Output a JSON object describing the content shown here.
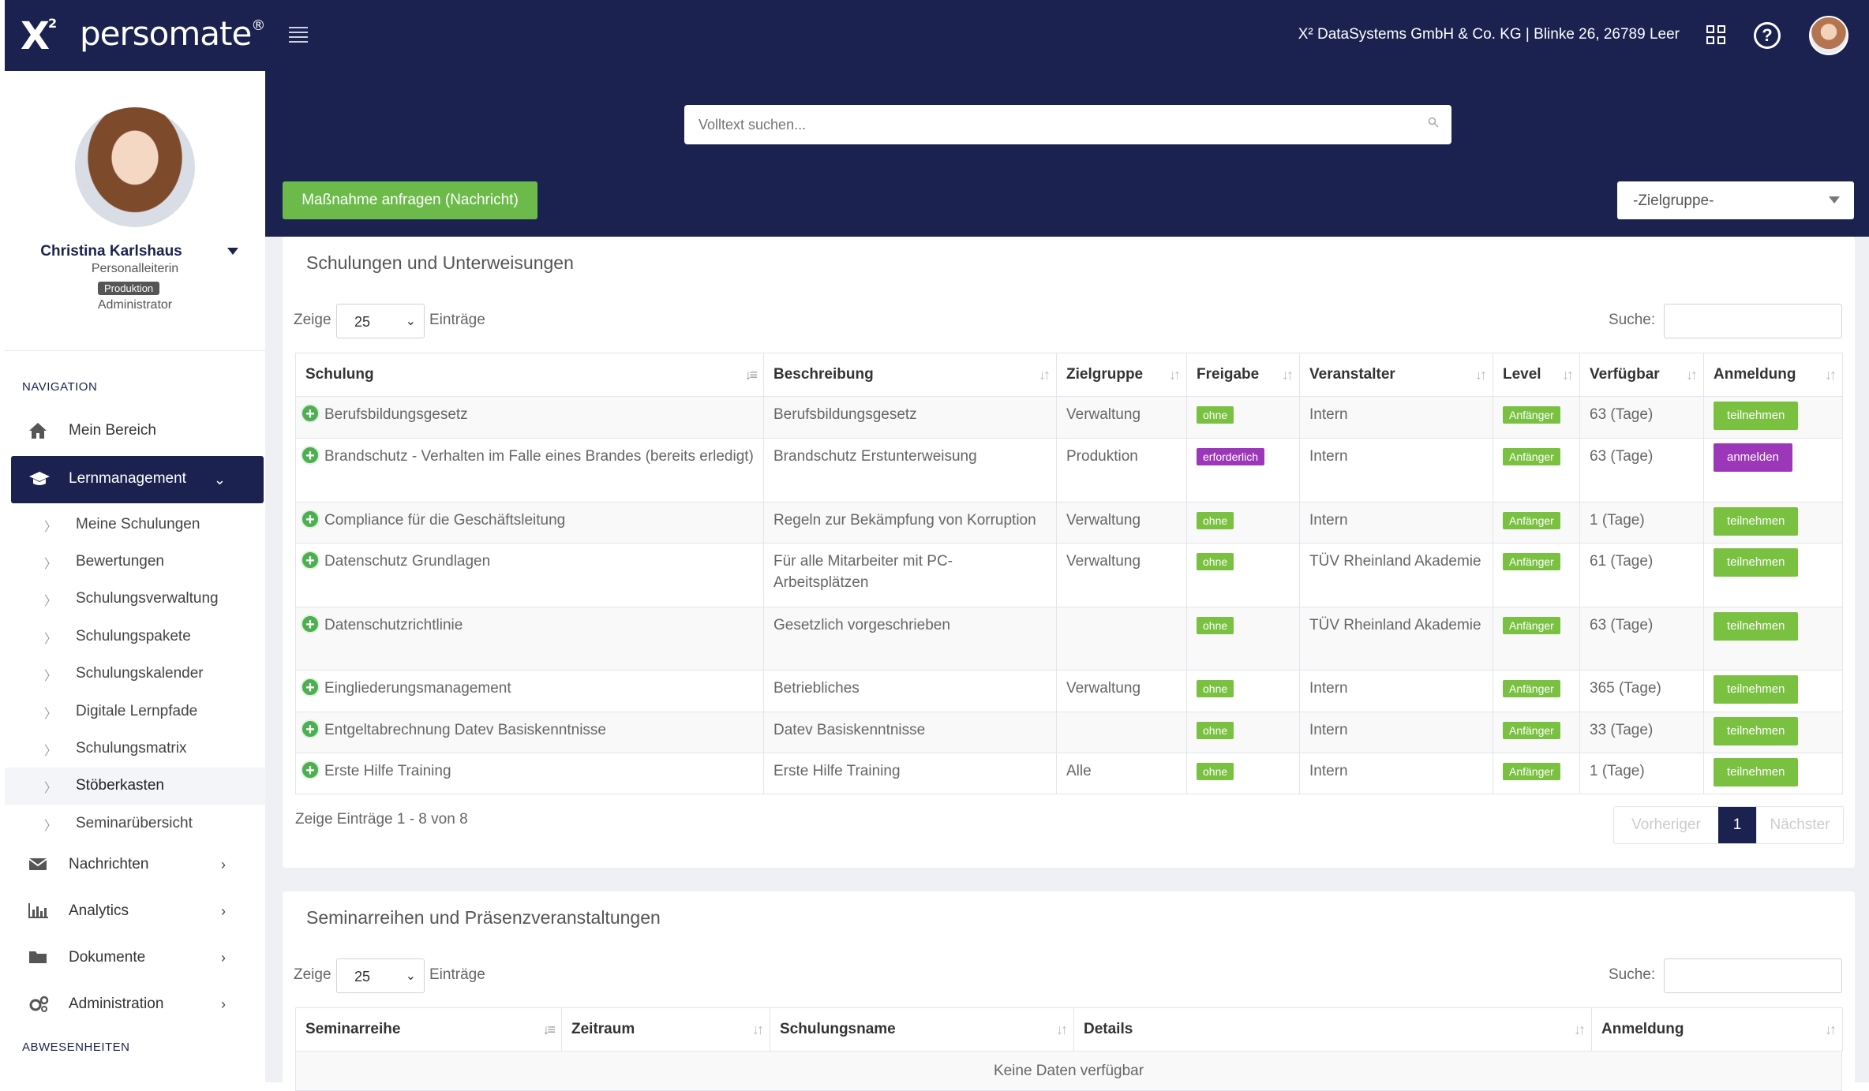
{
  "header": {
    "logo_x2": "X",
    "logo_sup": "2",
    "logo_name": "persomate",
    "logo_reg": "®",
    "company": "X² DataSystems GmbH & Co. KG | Blinke 26, 26789 Leer",
    "icons": [
      "menu-icon",
      "grid-icon",
      "help-icon",
      "avatar"
    ]
  },
  "profile": {
    "name": "Christina Karlshaus",
    "role": "Personalleiterin",
    "badge": "Produktion",
    "level": "Administrator"
  },
  "nav": {
    "title": "NAVIGATION",
    "mein_bereich": "Mein Bereich",
    "lernmanagement": "Lernmanagement",
    "sub_items": [
      "Meine Schulungen",
      "Bewertungen",
      "Schulungsverwaltung",
      "Schulungspakete",
      "Schulungskalender",
      "Digitale Lernpfade",
      "Schulungsmatrix",
      "Stöberkasten",
      "Seminarübersicht"
    ],
    "nachrichten": "Nachrichten",
    "analytics": "Analytics",
    "dokumente": "Dokumente",
    "administration": "Administration",
    "abwesenheiten": "ABWESENHEITEN"
  },
  "search": {
    "placeholder": "Volltext suchen..."
  },
  "request_button": "Maßnahme anfragen (Nachricht)",
  "zielgruppe_select": "-Zielgruppe-",
  "panel1": {
    "title": "Schulungen und Unterweisungen",
    "show_label": "Zeige",
    "show_value": "25",
    "entries_label": "Einträge",
    "search_label": "Suche:",
    "columns": [
      "Schulung",
      "Beschreibung",
      "Zielgruppe",
      "Freigabe",
      "Veranstalter",
      "Level",
      "Verfügbar",
      "Anmeldung"
    ],
    "rows": [
      {
        "schulung": "Berufsbildungsgesetz",
        "beschreibung": "Berufsbildungsgesetz",
        "zielgruppe": "Verwaltung",
        "freigabe": "ohne",
        "veranstalter": "Intern",
        "level": "Anfänger",
        "verfuegbar": "63  (Tage)",
        "anmeldung": "teilnehmen"
      },
      {
        "schulung": "Brandschutz - Verhalten im Falle eines Brandes (bereits erledigt)",
        "beschreibung": "Brandschutz Erstunterweisung",
        "zielgruppe": "Produktion",
        "freigabe": "erforderlich",
        "veranstalter": "Intern",
        "level": "Anfänger",
        "verfuegbar": "63  (Tage)",
        "anmeldung": "anmelden"
      },
      {
        "schulung": "Compliance für die Geschäftsleitung",
        "beschreibung": "Regeln zur Bekämpfung von Korruption",
        "zielgruppe": "Verwaltung",
        "freigabe": "ohne",
        "veranstalter": "Intern",
        "level": "Anfänger",
        "verfuegbar": "1  (Tage)",
        "anmeldung": "teilnehmen"
      },
      {
        "schulung": "Datenschutz Grundlagen",
        "beschreibung": "Für alle Mitarbeiter mit PC-Arbeitsplätzen",
        "zielgruppe": "Verwaltung",
        "freigabe": "ohne",
        "veranstalter": "TÜV Rheinland Akademie",
        "level": "Anfänger",
        "verfuegbar": "61  (Tage)",
        "anmeldung": "teilnehmen"
      },
      {
        "schulung": "Datenschutzrichtlinie",
        "beschreibung": "Gesetzlich vorgeschrieben",
        "zielgruppe": "",
        "freigabe": "ohne",
        "veranstalter": "TÜV Rheinland Akademie",
        "level": "Anfänger",
        "verfuegbar": "63  (Tage)",
        "anmeldung": "teilnehmen"
      },
      {
        "schulung": "Eingliederungsmanagement",
        "beschreibung": "Betriebliches",
        "zielgruppe": "Verwaltung",
        "freigabe": "ohne",
        "veranstalter": "Intern",
        "level": "Anfänger",
        "verfuegbar": "365  (Tage)",
        "anmeldung": "teilnehmen"
      },
      {
        "schulung": "Entgeltabrechnung Datev Basiskenntnisse",
        "beschreibung": "Datev Basiskenntnisse",
        "zielgruppe": "",
        "freigabe": "ohne",
        "veranstalter": "Intern",
        "level": "Anfänger",
        "verfuegbar": "33  (Tage)",
        "anmeldung": "teilnehmen"
      },
      {
        "schulung": "Erste Hilfe Training",
        "beschreibung": "Erste Hilfe Training",
        "zielgruppe": "Alle",
        "freigabe": "ohne",
        "veranstalter": "Intern",
        "level": "Anfänger",
        "verfuegbar": "1  (Tage)",
        "anmeldung": "teilnehmen"
      }
    ],
    "info": "Zeige Einträge 1 - 8 von 8",
    "prev": "Vorheriger",
    "page": "1",
    "next": "Nächster"
  },
  "panel2": {
    "title": "Seminarreihen und Präsenzveranstaltungen",
    "show_label": "Zeige",
    "show_value": "25",
    "entries_label": "Einträge",
    "search_label": "Suche:",
    "columns": [
      "Seminarreihe",
      "Zeitraum",
      "Schulungsname",
      "Details",
      "Anmeldung"
    ],
    "empty": "Keine Daten verfügbar"
  },
  "colors": {
    "navy": "#1b2250",
    "green": "#7ac142",
    "purple": "#9b37b8",
    "request_green": "#6cbb4a"
  }
}
